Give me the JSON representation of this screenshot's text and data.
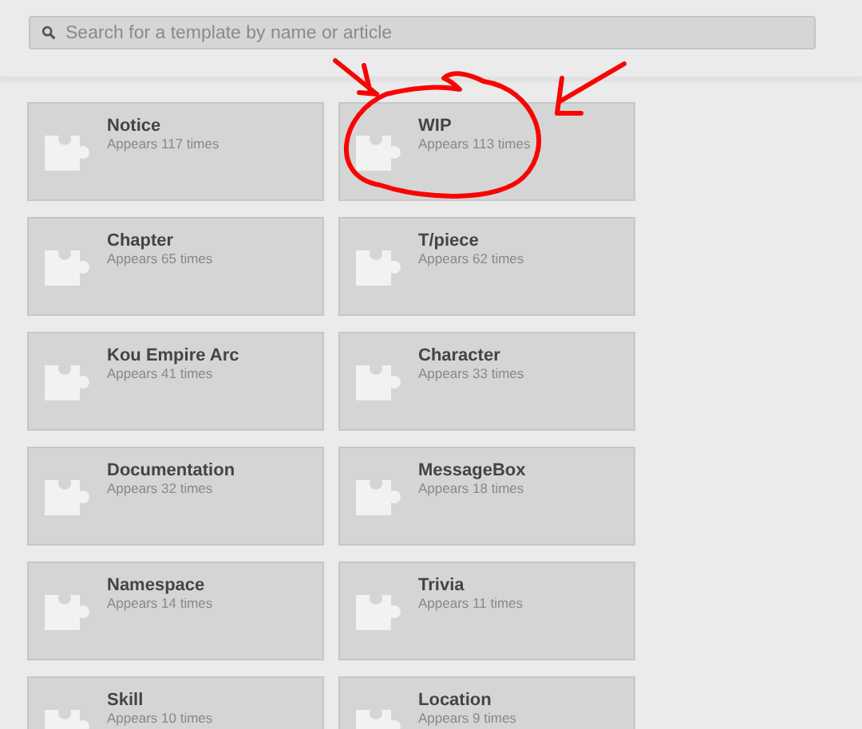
{
  "search": {
    "placeholder": "Search for a template by name or article"
  },
  "templates": [
    {
      "name": "Notice",
      "usage": "Appears 117 times"
    },
    {
      "name": "WIP",
      "usage": "Appears 113 times"
    },
    {
      "name": "Chapter",
      "usage": "Appears 65 times"
    },
    {
      "name": "T/piece",
      "usage": "Appears 62 times"
    },
    {
      "name": "Kou Empire Arc",
      "usage": "Appears 41 times"
    },
    {
      "name": "Character",
      "usage": "Appears 33 times"
    },
    {
      "name": "Documentation",
      "usage": "Appears 32 times"
    },
    {
      "name": "MessageBox",
      "usage": "Appears 18 times"
    },
    {
      "name": "Namespace",
      "usage": "Appears 14 times"
    },
    {
      "name": "Trivia",
      "usage": "Appears 11 times"
    },
    {
      "name": "Skill",
      "usage": "Appears 10 times"
    },
    {
      "name": "Location",
      "usage": "Appears 9 times"
    }
  ]
}
